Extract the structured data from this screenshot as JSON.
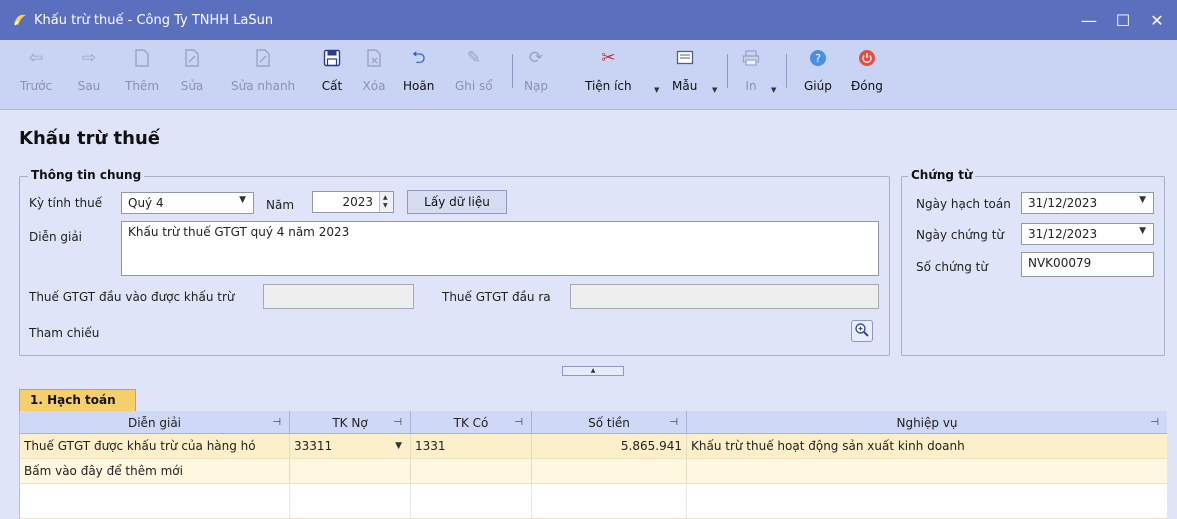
{
  "window": {
    "title": "Khấu trừ thuế - Công Ty TNHH LaSun"
  },
  "toolbar": {
    "back": "Trước",
    "forward": "Sau",
    "add": "Thêm",
    "edit": "Sửa",
    "quick_edit": "Sửa nhanh",
    "save": "Cất",
    "delete": "Xóa",
    "undo": "Hoãn",
    "post": "Ghi sổ",
    "reload": "Nạp",
    "utilities": "Tiện ích",
    "template": "Mẫu",
    "print": "In",
    "help": "Giúp",
    "close": "Đóng"
  },
  "page": {
    "title": "Khấu trừ thuế"
  },
  "general": {
    "legend": "Thông tin chung",
    "period_label": "Kỳ tính thuế",
    "period_value": "Quý 4",
    "year_label": "Năm",
    "year_value": "2023",
    "fetch_button": "Lấy dữ liệu",
    "description_label": "Diễn giải",
    "description_value": "Khấu trừ thuế GTGT quý 4 năm 2023",
    "input_vat_label": "Thuế GTGT đầu vào được khấu trừ",
    "input_vat_value": "",
    "output_vat_label": "Thuế GTGT đầu ra",
    "output_vat_value": "",
    "reference_label": "Tham chiếu"
  },
  "voucher": {
    "legend": "Chứng từ",
    "posting_date_label": "Ngày hạch toán",
    "posting_date_value": "31/12/2023",
    "voucher_date_label": "Ngày chứng từ",
    "voucher_date_value": "31/12/2023",
    "voucher_no_label": "Số chứng từ",
    "voucher_no_value": "NVK00079"
  },
  "grid": {
    "tab_label": "1. Hạch toán",
    "columns": [
      "Diễn giải",
      "TK Nợ",
      "TK Có",
      "Số tiền",
      "Nghiệp vụ"
    ],
    "rows": [
      {
        "description": "Thuế GTGT được khấu trừ của hàng hó",
        "debit": "33311",
        "credit": "1331",
        "amount": "5.865.941",
        "operation": "Khấu trừ thuế hoạt động sản xuất kinh doanh"
      }
    ],
    "add_new_text": "Bấm vào đây để thêm mới"
  },
  "colors": {
    "titlebar": "#5b6fbf",
    "toolbar": "#c9d3f3",
    "content_bg": "#dfe4f8",
    "tab_active": "#f5cf6c",
    "selected_row": "#fcefc9"
  }
}
